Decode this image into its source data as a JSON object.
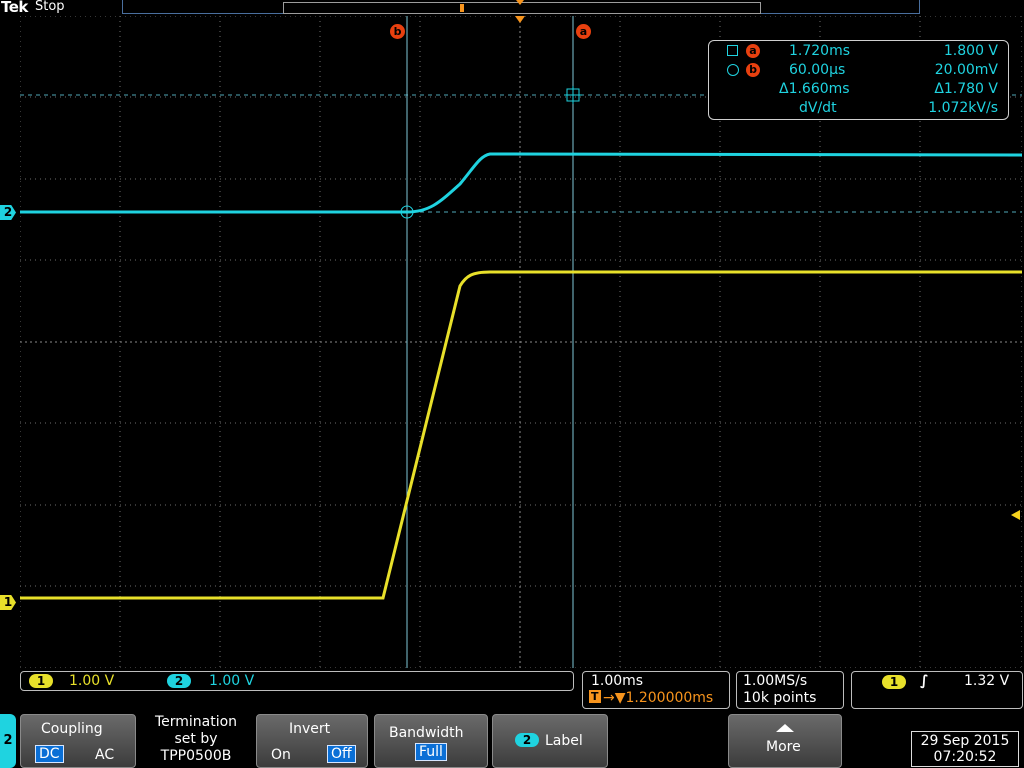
{
  "header": {
    "brand": "Tek",
    "state": "Stop"
  },
  "cursors": {
    "a_label": "a",
    "b_label": "b"
  },
  "channel_markers": {
    "ch1": "1",
    "ch2": "2"
  },
  "readout": {
    "a_time": "1.720ms",
    "a_volt": "1.800 V",
    "b_time": "60.00µs",
    "b_volt": "20.00mV",
    "delta_time": "Δ1.660ms",
    "delta_volt": "Δ1.780 V",
    "dvdt_label": "dV/dt",
    "dvdt_value": "1.072kV/s"
  },
  "status": {
    "ch1_num": "1",
    "ch1_scale": "1.00 V",
    "ch2_num": "2",
    "ch2_scale": "1.00 V",
    "timebase": "1.00ms",
    "trigger_pos_icon": "T",
    "trigger_delay": "→▼1.200000ms",
    "sample_rate": "1.00MS/s",
    "record_length": "10k points",
    "trig_source": "1",
    "trig_slope": "∫",
    "trig_level": "1.32 V"
  },
  "menu": {
    "channel_tab": "2",
    "coupling_title": "Coupling",
    "coupling_dc": "DC",
    "coupling_ac": "AC",
    "termination_line1": "Termination",
    "termination_line2": "set by",
    "termination_line3": "TPP0500B",
    "invert_title": "Invert",
    "invert_on": "On",
    "invert_off": "Off",
    "bandwidth_title": "Bandwidth",
    "bandwidth_value": "Full",
    "label_num": "2",
    "label_text": "Label",
    "more_text": "More",
    "date": "29 Sep  2015",
    "time": "07:20:52"
  },
  "colors": {
    "ch1": "#e8e02a",
    "ch2": "#1fd3e0",
    "cursor": "#e8400f",
    "trigger": "#f7941d"
  },
  "icons": {
    "square_cursor": "square-icon",
    "circle_cursor": "circle-icon",
    "more": "up-arrow-icon"
  }
}
